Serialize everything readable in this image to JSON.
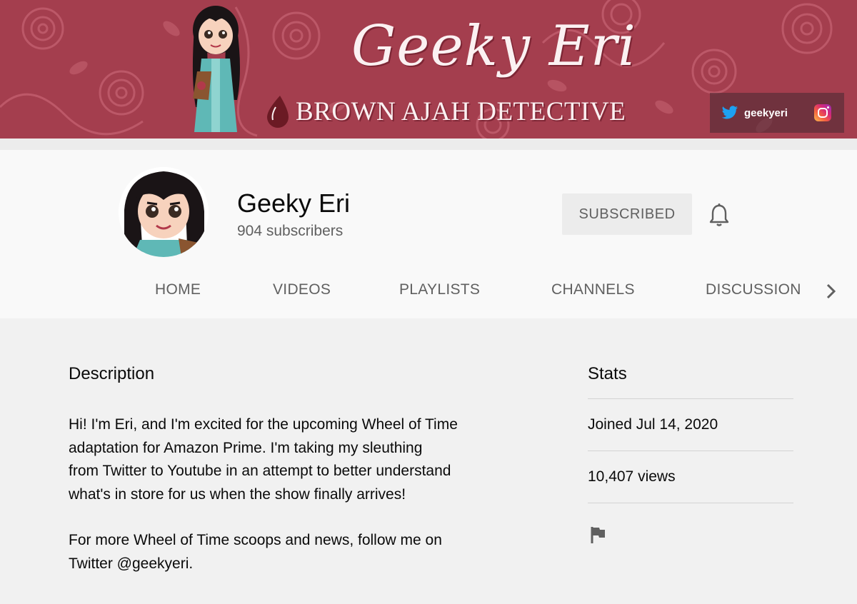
{
  "banner": {
    "title": "Geeky Eri",
    "subtitle": "BROWN AJAH DETECTIVE",
    "twitter_handle": "geekyeri",
    "icons": [
      "twitter-icon",
      "instagram-icon",
      "drop-icon"
    ]
  },
  "channel": {
    "name": "Geeky Eri",
    "subscribers": "904 subscribers",
    "subscribe_label": "SUBSCRIBED",
    "bell_icon": "bell-icon"
  },
  "tabs": [
    {
      "label": "HOME"
    },
    {
      "label": "VIDEOS"
    },
    {
      "label": "PLAYLISTS"
    },
    {
      "label": "CHANNELS"
    },
    {
      "label": "DISCUSSION"
    }
  ],
  "about": {
    "description_heading": "Description",
    "description_lines_1": [
      "Hi! I'm Eri, and I'm excited for the upcoming Wheel of Time",
      "adaptation for Amazon Prime. I'm taking my sleuthing",
      "from Twitter to Youtube in an attempt to better understand",
      "what's in store for us when the show finally arrives!"
    ],
    "description_lines_2": [
      "For more Wheel of Time scoops and news, follow me on",
      "Twitter @geekyeri."
    ],
    "stats_heading": "Stats",
    "joined": "Joined Jul 14, 2020",
    "views": "10,407 views"
  },
  "colors": {
    "banner_bg": "#a43e4e",
    "banner_text": "#fbf1f2",
    "header_bg": "#f9f9f9",
    "page_bg": "#f1f1f1",
    "muted_text": "#606060"
  }
}
